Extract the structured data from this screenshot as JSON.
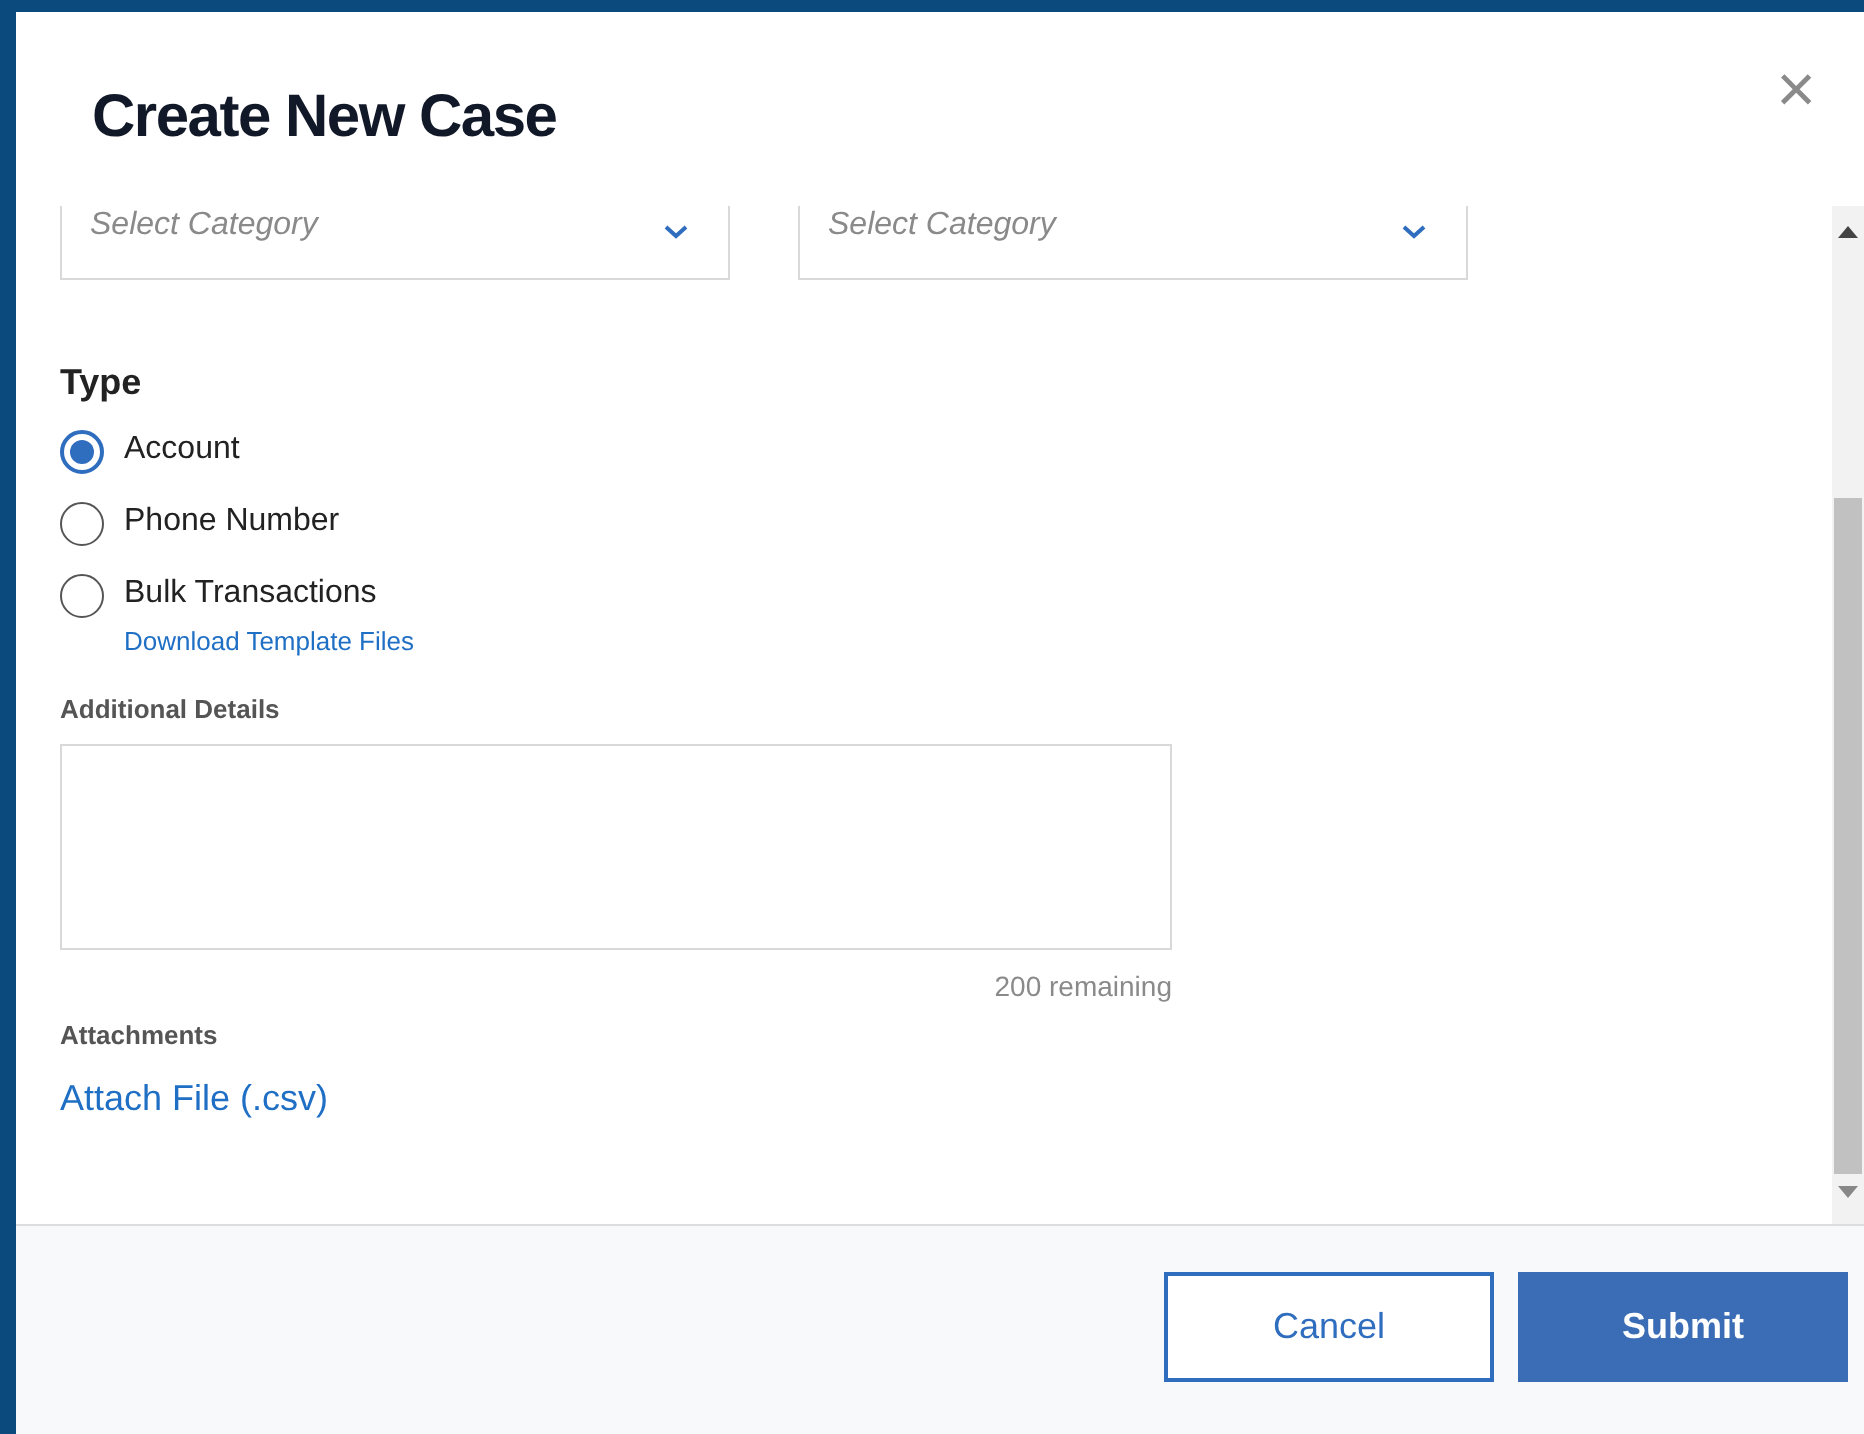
{
  "dialog": {
    "title": "Create New Case",
    "close": "×"
  },
  "selects": [
    {
      "placeholder": "Select Category"
    },
    {
      "placeholder": "Select Category"
    }
  ],
  "type_section": {
    "heading": "Type",
    "options": [
      {
        "label": "Account",
        "selected": true
      },
      {
        "label": "Phone Number",
        "selected": false
      },
      {
        "label": "Bulk Transactions",
        "selected": false,
        "link": "Download Template Files"
      }
    ]
  },
  "details": {
    "label": "Additional Details",
    "counter": "200 remaining"
  },
  "attachments": {
    "label": "Attachments",
    "link": "Attach File (.csv)"
  },
  "buttons": [
    {
      "label": "Cancel",
      "kind": "secondary"
    },
    {
      "label": "Submit",
      "kind": "primary"
    }
  ]
}
